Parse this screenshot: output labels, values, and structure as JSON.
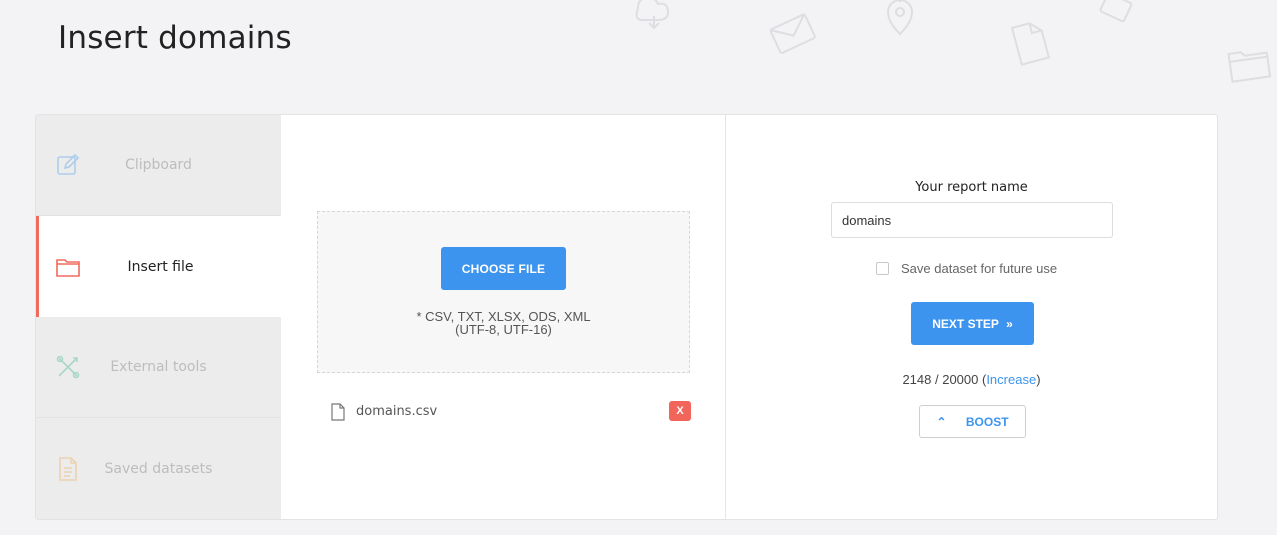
{
  "page": {
    "title": "Insert domains"
  },
  "sidebar": {
    "items": [
      {
        "label": "Clipboard",
        "icon": "edit-icon"
      },
      {
        "label": "Insert file",
        "icon": "folder-icon",
        "active": true
      },
      {
        "label": "External tools",
        "icon": "tools-icon"
      },
      {
        "label": "Saved datasets",
        "icon": "document-icon"
      }
    ]
  },
  "upload": {
    "choose_label": "CHOOSE FILE",
    "formats_line1": "* CSV, TXT, XLSX, ODS, XML",
    "formats_line2": "(UTF-8, UTF-16)",
    "file_name": "domains.csv",
    "remove_label": "X"
  },
  "report": {
    "label": "Your report name",
    "value": "domains",
    "save_label": "Save dataset for future use",
    "save_checked": false,
    "next_label": "NEXT STEP",
    "quota_text": "2148 / 20000 (",
    "increase_label": "Increase",
    "quota_close": ")",
    "boost_label": "BOOST"
  },
  "colors": {
    "accent": "#3d94ee",
    "active_border": "#f06b5d",
    "remove": "#f2655a"
  }
}
